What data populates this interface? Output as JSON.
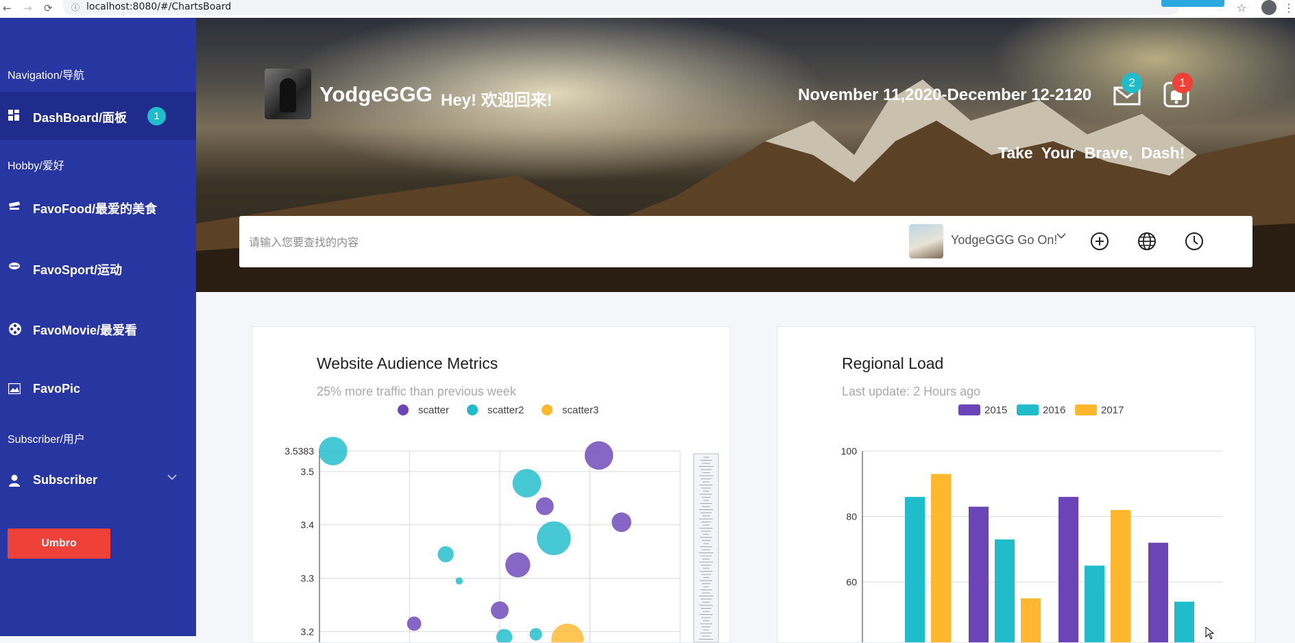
{
  "browser": {
    "url": "localhost:8080/#/ChartsBoard",
    "back": "←",
    "forward": "→",
    "reload": "⟳",
    "info": "ⓘ",
    "star": "☆",
    "menu": "⋮"
  },
  "sidebar": {
    "groups": [
      "Navigation/导航",
      "Hobby/爱好",
      "Subscriber/用户"
    ],
    "items": [
      {
        "label": "DashBoard/面板",
        "icon": "dashboard-icon",
        "badge": "1"
      },
      {
        "label": "FavoFood/最爱的美食",
        "icon": "food-icon"
      },
      {
        "label": "FavoSport/运动",
        "icon": "sport-icon"
      },
      {
        "label": "FavoMovie/最爱看",
        "icon": "movie-icon"
      },
      {
        "label": "FavoPic",
        "icon": "picture-icon"
      },
      {
        "label": "Subscriber",
        "icon": "user-icon"
      }
    ],
    "button": "Umbro",
    "colors": {
      "background": "#2736a0",
      "active": "#1f2c8c",
      "badge": "#1fbccc",
      "button": "#f04138"
    }
  },
  "header": {
    "name": "YodgeGGG",
    "greeting": "Hey!  欢迎回来!",
    "date_range": "November 11,2020-December 12-2120",
    "tagline": "Take  Your  Brave,  Dash!",
    "mail_badge": "2",
    "bell_badge": "1",
    "mail_badge_color": "#1fbccc",
    "bell_badge_color": "#f04138"
  },
  "search": {
    "placeholder": "请输入您要查找的内容",
    "user_label": "YodgeGGG Go On!",
    "actions": [
      "plus-circle-icon",
      "globe-icon",
      "clock-icon"
    ]
  },
  "cards": [
    {
      "title": "Website Audience Metrics",
      "subtitle": "25% more traffic than previous week"
    },
    {
      "title": "Regional Load",
      "subtitle": "Last update: 2 Hours ago"
    }
  ],
  "chart_data": [
    {
      "type": "scatter",
      "series": [
        {
          "name": "scatter",
          "color": "#6b45b8",
          "points": [
            [
              1.05,
              3.215,
              8
            ],
            [
              2.0,
              3.24,
              10
            ],
            [
              2.2,
              3.325,
              14
            ],
            [
              2.5,
              3.435,
              10
            ],
            [
              3.1,
              3.53,
              16
            ],
            [
              3.35,
              3.405,
              11
            ]
          ]
        },
        {
          "name": "scatter2",
          "color": "#1fbccc",
          "points": [
            [
              0.15,
              3.5383,
              16
            ],
            [
              1.4,
              3.345,
              9
            ],
            [
              1.55,
              3.295,
              4
            ],
            [
              2.05,
              3.19,
              9
            ],
            [
              2.4,
              3.195,
              7
            ],
            [
              2.3,
              3.478,
              16
            ],
            [
              2.6,
              3.375,
              19
            ]
          ]
        },
        {
          "name": "scatter3",
          "color": "#ffb82e",
          "points": [
            [
              2.75,
              3.185,
              18
            ]
          ]
        }
      ],
      "ylim": [
        3.18,
        3.5383
      ],
      "yticks": [
        "3.5383",
        "3.5",
        "3.4",
        "3.3",
        "3.2"
      ],
      "grid": true,
      "legend": "top-center"
    },
    {
      "type": "bar",
      "series": [
        {
          "name": "2015",
          "color": "#6b45b8",
          "values": [
            null,
            83,
            86,
            72
          ]
        },
        {
          "name": "2016",
          "color": "#1fbccc",
          "values": [
            86,
            73,
            65,
            54
          ]
        },
        {
          "name": "2017",
          "color": "#ffb82e",
          "values": [
            93,
            55,
            82,
            null
          ]
        }
      ],
      "ylim": [
        55,
        100
      ],
      "yticks": [
        "100",
        "80",
        "60"
      ],
      "grid": true,
      "legend": "top-center"
    }
  ]
}
